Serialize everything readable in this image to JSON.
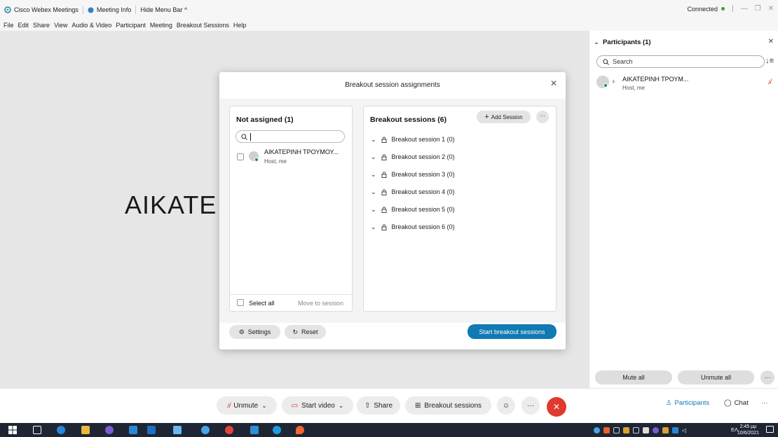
{
  "window": {
    "app_title": "Cisco Webex Meetings",
    "meeting_info": "Meeting Info",
    "hide_menu_bar": "Hide Menu Bar ^",
    "status": "Connected"
  },
  "menu": [
    "File",
    "Edit",
    "Share",
    "View",
    "Audio & Video",
    "Participant",
    "Meeting",
    "Breakout Sessions",
    "Help"
  ],
  "stage": {
    "name_text": "AIKATE"
  },
  "dialog": {
    "title": "Breakout session assignments",
    "not_assigned": {
      "heading": "Not assigned (1)",
      "participant_name": "ΑΙΚΑΤΕΡΙΝΗ ΤΡΟΥΜΟΥ...",
      "participant_role": "Host, me",
      "select_all": "Select all",
      "move_to_session": "Move to session"
    },
    "sessions": {
      "heading": "Breakout sessions (6)",
      "add_session": "Add Session",
      "more": "···",
      "items": [
        "Breakout session 1 (0)",
        "Breakout session 2 (0)",
        "Breakout session 3 (0)",
        "Breakout session 4 (0)",
        "Breakout session 5 (0)",
        "Breakout session 6 (0)"
      ]
    },
    "settings": "Settings",
    "reset": "Reset",
    "start": "Start breakout sessions"
  },
  "participants_pane": {
    "heading": "Participants (1)",
    "search_placeholder": "Search",
    "participant_name": "ΑΙΚΑΤΕΡΙΝΗ ΤΡΟΥΜ...",
    "participant_role": "Host, me",
    "mute_all": "Mute all",
    "unmute_all": "Unmute all"
  },
  "controls": {
    "unmute": "Unmute",
    "start_video": "Start video",
    "share": "Share",
    "breakout_sessions": "Breakout sessions",
    "participants": "Participants",
    "chat": "Chat"
  },
  "taskbar": {
    "lang": "ΕΛ",
    "time": "2:45 μμ",
    "date": "10/6/2021"
  },
  "colors": {
    "accent": "#0f7ab3",
    "end_call": "#e03a2e",
    "status_green": "#2ea043",
    "taskbar": "#1e2633"
  }
}
